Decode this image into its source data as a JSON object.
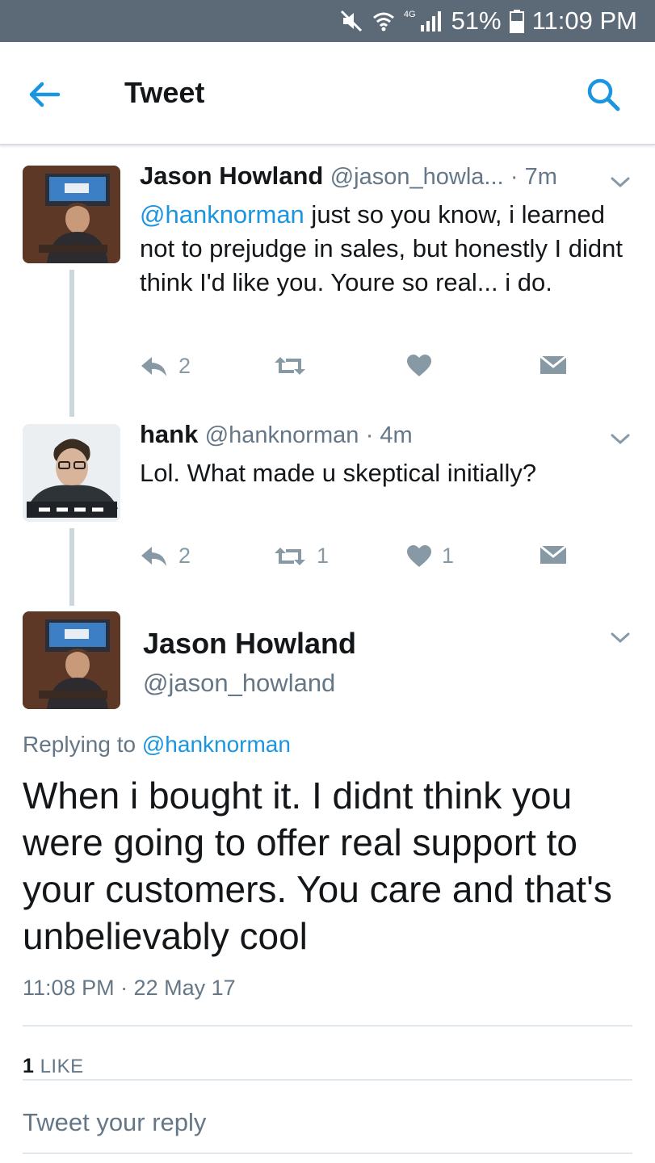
{
  "status_bar": {
    "network": "4G",
    "battery": "51%",
    "time": "11:09 PM"
  },
  "app_bar": {
    "title": "Tweet"
  },
  "thread": [
    {
      "name": "Jason Howland",
      "handle": "@jason_howla...",
      "time": "· 7m",
      "mention": "@hanknorman",
      "text": " just so you know, i learned not to prejudge in sales, but honestly I didnt think I'd like you. Youre so real... i do.",
      "replies": "2",
      "retweets": "",
      "likes": ""
    },
    {
      "name": "hank",
      "handle": "@hanknorman",
      "time": "· 4m",
      "mention": "",
      "text": "Lol. What made u skeptical initially?",
      "replies": "2",
      "retweets": "1",
      "likes": "1"
    }
  ],
  "focus_tweet": {
    "name": "Jason Howland",
    "handle": "@jason_howland",
    "replying_prefix": "Replying to ",
    "replying_to": "@hanknorman",
    "text": "When i bought it. I didnt think you were going to offer real support to your customers. You care and that's unbelievably cool",
    "timestamp": "11:08 PM · 22 May 17",
    "like_count": "1",
    "like_label": "LIKE"
  },
  "reply_input": {
    "placeholder": "Tweet your reply"
  },
  "colors": {
    "accent": "#1b95e0",
    "status_bar": "#5c6976",
    "secondary_text": "#657786",
    "action_icons": "#8899a6"
  }
}
